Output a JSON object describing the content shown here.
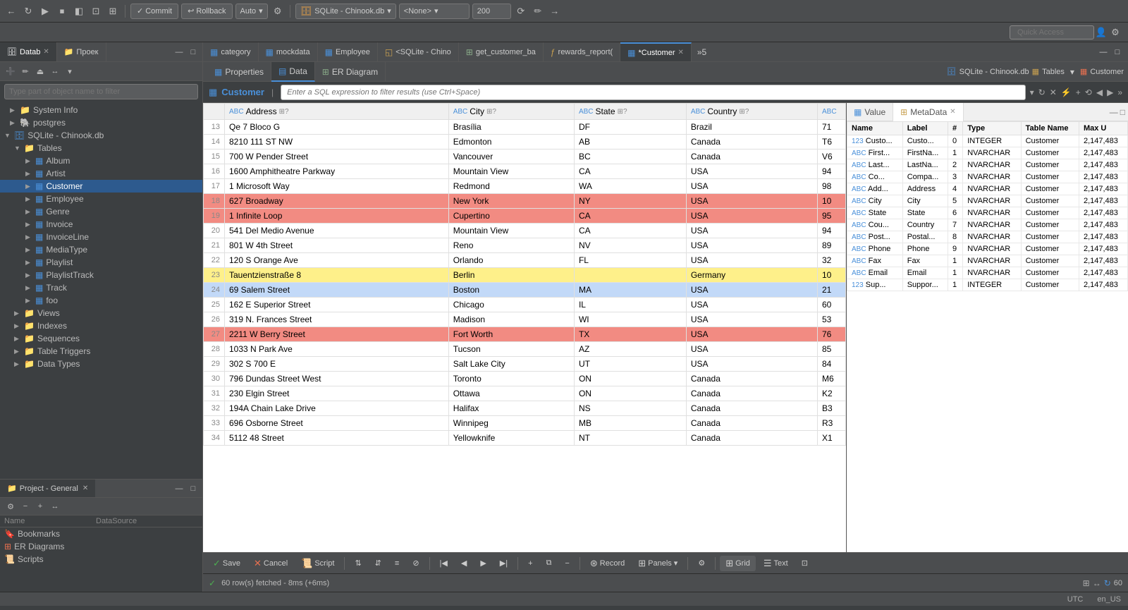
{
  "toolbar": {
    "commit_label": "Commit",
    "rollback_label": "Rollback",
    "auto_label": "Auto",
    "db_label": "SQLite - Chinook.db",
    "schema_label": "<None>",
    "rows_label": "200",
    "quick_access_label": "Quick Access"
  },
  "sidebar": {
    "tab1": "Datab",
    "tab2": "Проек",
    "filter_placeholder": "Type part of object name to filter",
    "tree_items": [
      {
        "id": "sys",
        "label": "System Info",
        "icon": "folder",
        "level": 1,
        "expanded": false
      },
      {
        "id": "pg",
        "label": "postgres",
        "icon": "db",
        "level": 1,
        "expanded": false
      },
      {
        "id": "sqlite",
        "label": "SQLite - Chinook.db",
        "icon": "db",
        "level": 1,
        "expanded": true
      },
      {
        "id": "tables",
        "label": "Tables",
        "icon": "folder",
        "level": 2,
        "expanded": true
      },
      {
        "id": "album",
        "label": "Album",
        "icon": "table",
        "level": 3
      },
      {
        "id": "artist",
        "label": "Artist",
        "icon": "table",
        "level": 3
      },
      {
        "id": "customer",
        "label": "Customer",
        "icon": "table",
        "level": 3,
        "selected": true
      },
      {
        "id": "employee",
        "label": "Employee",
        "icon": "table",
        "level": 3
      },
      {
        "id": "genre",
        "label": "Genre",
        "icon": "table",
        "level": 3
      },
      {
        "id": "invoice",
        "label": "Invoice",
        "icon": "table",
        "level": 3
      },
      {
        "id": "invoiceline",
        "label": "InvoiceLine",
        "icon": "table",
        "level": 3
      },
      {
        "id": "mediatype",
        "label": "MediaType",
        "icon": "table",
        "level": 3
      },
      {
        "id": "playlist",
        "label": "Playlist",
        "icon": "table",
        "level": 3
      },
      {
        "id": "playlisttrack",
        "label": "PlaylistTrack",
        "icon": "table",
        "level": 3
      },
      {
        "id": "track",
        "label": "Track",
        "icon": "table",
        "level": 3
      },
      {
        "id": "foo",
        "label": "foo",
        "icon": "table",
        "level": 3
      },
      {
        "id": "views",
        "label": "Views",
        "icon": "folder",
        "level": 2,
        "expanded": false
      },
      {
        "id": "indexes",
        "label": "Indexes",
        "icon": "folder",
        "level": 2,
        "expanded": false
      },
      {
        "id": "sequences",
        "label": "Sequences",
        "icon": "folder",
        "level": 2,
        "expanded": false
      },
      {
        "id": "tabletriggers",
        "label": "Table Triggers",
        "icon": "folder",
        "level": 2,
        "expanded": false
      },
      {
        "id": "datatypes",
        "label": "Data Types",
        "icon": "folder",
        "level": 2,
        "expanded": false
      }
    ]
  },
  "project": {
    "tab_label": "Project - General",
    "name_col": "Name",
    "datasource_col": "DataSource",
    "items": [
      {
        "name": "Bookmarks",
        "icon": "bookmark",
        "datasource": ""
      },
      {
        "name": "ER Diagrams",
        "icon": "er",
        "datasource": ""
      },
      {
        "name": "Scripts",
        "icon": "script",
        "datasource": ""
      }
    ]
  },
  "editor_tabs": [
    {
      "label": "category",
      "icon": "table",
      "active": false
    },
    {
      "label": "mockdata",
      "icon": "table",
      "active": false
    },
    {
      "label": "Employee",
      "icon": "table",
      "active": false
    },
    {
      "label": "<SQLite - Chino",
      "icon": "sql",
      "active": false
    },
    {
      "label": "get_customer_ba",
      "icon": "view",
      "active": false
    },
    {
      "label": "rewards_report(",
      "icon": "func",
      "active": false
    },
    {
      "label": "*Customer",
      "icon": "table",
      "active": true,
      "modified": true
    },
    {
      "label": "»5",
      "more": true
    }
  ],
  "sub_tabs": [
    {
      "label": "Properties",
      "icon": "props",
      "active": false
    },
    {
      "label": "Data",
      "icon": "data",
      "active": true
    },
    {
      "label": "ER Diagram",
      "icon": "er",
      "active": false
    }
  ],
  "sub_toolbar_right": {
    "db_label": "SQLite - Chinook.db",
    "tables_label": "Tables",
    "customer_label": "Customer"
  },
  "filter": {
    "table_name": "Customer",
    "placeholder": "Enter a SQL expression to filter results (use Ctrl+Space)"
  },
  "table_columns": [
    {
      "label": "Address",
      "type": "ABC"
    },
    {
      "label": "City",
      "type": "ABC"
    },
    {
      "label": "State",
      "type": "ABC"
    },
    {
      "label": "Country",
      "type": "ABC"
    },
    {
      "label": "...",
      "type": "ABC"
    }
  ],
  "table_rows": [
    {
      "num": 13,
      "address": "Qe 7 Bloco G",
      "city": "Brasília",
      "state": "DF",
      "country": "Brazil",
      "extra": "71",
      "style": ""
    },
    {
      "num": 14,
      "address": "8210 111 ST NW",
      "city": "Edmonton",
      "state": "AB",
      "country": "Canada",
      "extra": "T6",
      "style": ""
    },
    {
      "num": 15,
      "address": "700 W Pender Street",
      "city": "Vancouver",
      "state": "BC",
      "country": "Canada",
      "extra": "V6",
      "style": ""
    },
    {
      "num": 16,
      "address": "1600 Amphitheatre Parkway",
      "city": "Mountain View",
      "state": "CA",
      "country": "USA",
      "extra": "94",
      "style": ""
    },
    {
      "num": 17,
      "address": "1 Microsoft Way",
      "city": "Redmond",
      "state": "WA",
      "country": "USA",
      "extra": "98",
      "style": ""
    },
    {
      "num": 18,
      "address": "627 Broadway",
      "city": "New York",
      "state": "NY",
      "country": "USA",
      "extra": "10",
      "style": "row-red"
    },
    {
      "num": 19,
      "address": "1 Infinite Loop",
      "city": "Cupertino",
      "state": "CA",
      "country": "USA",
      "extra": "95",
      "style": "row-red"
    },
    {
      "num": 20,
      "address": "541 Del Medio Avenue",
      "city": "Mountain View",
      "state": "CA",
      "country": "USA",
      "extra": "94",
      "style": ""
    },
    {
      "num": 21,
      "address": "801 W 4th Street",
      "city": "Reno",
      "state": "NV",
      "country": "USA",
      "extra": "89",
      "style": ""
    },
    {
      "num": 22,
      "address": "120 S Orange Ave",
      "city": "Orlando",
      "state": "FL",
      "country": "USA",
      "extra": "32",
      "style": ""
    },
    {
      "num": 23,
      "address": "Tauentzienstraße 8",
      "city": "Berlin",
      "state": "",
      "country": "Germany",
      "extra": "10",
      "style": "row-yellow"
    },
    {
      "num": 24,
      "address": "69 Salem Street",
      "city": "Boston",
      "state": "MA",
      "country": "USA",
      "extra": "21",
      "style": "row-selected"
    },
    {
      "num": 25,
      "address": "162 E Superior Street",
      "city": "Chicago",
      "state": "IL",
      "country": "USA",
      "extra": "60",
      "style": ""
    },
    {
      "num": 26,
      "address": "319 N. Frances Street",
      "city": "Madison",
      "state": "WI",
      "country": "USA",
      "extra": "53",
      "style": ""
    },
    {
      "num": 27,
      "address": "2211 W Berry Street",
      "city": "Fort Worth",
      "state": "TX",
      "country": "USA",
      "extra": "76",
      "style": "row-red"
    },
    {
      "num": 28,
      "address": "1033 N Park Ave",
      "city": "Tucson",
      "state": "AZ",
      "country": "USA",
      "extra": "85",
      "style": ""
    },
    {
      "num": 29,
      "address": "302 S 700 E",
      "city": "Salt Lake City",
      "state": "UT",
      "country": "USA",
      "extra": "84",
      "style": ""
    },
    {
      "num": 30,
      "address": "796 Dundas Street West",
      "city": "Toronto",
      "state": "ON",
      "country": "Canada",
      "extra": "M6",
      "style": ""
    },
    {
      "num": 31,
      "address": "230 Elgin Street",
      "city": "Ottawa",
      "state": "ON",
      "country": "Canada",
      "extra": "K2",
      "style": ""
    },
    {
      "num": 32,
      "address": "194A Chain Lake Drive",
      "city": "Halifax",
      "state": "NS",
      "country": "Canada",
      "extra": "B3",
      "style": ""
    },
    {
      "num": 33,
      "address": "696 Osborne Street",
      "city": "Winnipeg",
      "state": "MB",
      "country": "Canada",
      "extra": "R3",
      "style": ""
    },
    {
      "num": 34,
      "address": "5112 48 Street",
      "city": "Yellowknife",
      "state": "NT",
      "country": "Canada",
      "extra": "X1",
      "style": ""
    }
  ],
  "metadata": {
    "tab_value": "Value",
    "tab_meta": "MetaData",
    "columns": [
      "Name",
      "Label",
      "#",
      "Type",
      "Table Name",
      "Max U"
    ],
    "rows": [
      {
        "icon": "123",
        "name": "Custo...",
        "label": "Custo...",
        "num": "0",
        "type": "INTEGER",
        "table": "Customer",
        "max": "2,147,483"
      },
      {
        "icon": "ABC",
        "name": "First...",
        "label": "FirstNa...",
        "num": "1",
        "type": "NVARCHAR",
        "table": "Customer",
        "max": "2,147,483"
      },
      {
        "icon": "ABC",
        "name": "Last...",
        "label": "LastNa...",
        "num": "2",
        "type": "NVARCHAR",
        "table": "Customer",
        "max": "2,147,483"
      },
      {
        "icon": "ABC",
        "name": "Co...",
        "label": "Compa...",
        "num": "3",
        "type": "NVARCHAR",
        "table": "Customer",
        "max": "2,147,483"
      },
      {
        "icon": "ABC",
        "name": "Add...",
        "label": "Address",
        "num": "4",
        "type": "NVARCHAR",
        "table": "Customer",
        "max": "2,147,483"
      },
      {
        "icon": "ABC",
        "name": "City",
        "label": "City",
        "num": "5",
        "type": "NVARCHAR",
        "table": "Customer",
        "max": "2,147,483"
      },
      {
        "icon": "ABC",
        "name": "State",
        "label": "State",
        "num": "6",
        "type": "NVARCHAR",
        "table": "Customer",
        "max": "2,147,483"
      },
      {
        "icon": "ABC",
        "name": "Cou...",
        "label": "Country",
        "num": "7",
        "type": "NVARCHAR",
        "table": "Customer",
        "max": "2,147,483"
      },
      {
        "icon": "ABC",
        "name": "Post...",
        "label": "Postal...",
        "num": "8",
        "type": "NVARCHAR",
        "table": "Customer",
        "max": "2,147,483"
      },
      {
        "icon": "ABC",
        "name": "Phone",
        "label": "Phone",
        "num": "9",
        "type": "NVARCHAR",
        "table": "Customer",
        "max": "2,147,483"
      },
      {
        "icon": "ABC",
        "name": "Fax",
        "label": "Fax",
        "num": "1",
        "type": "NVARCHAR",
        "table": "Customer",
        "max": "2,147,483"
      },
      {
        "icon": "ABC",
        "name": "Email",
        "label": "Email",
        "num": "1",
        "type": "NVARCHAR",
        "table": "Customer",
        "max": "2,147,483"
      },
      {
        "icon": "123",
        "name": "Sup...",
        "label": "Suppor...",
        "num": "1",
        "type": "INTEGER",
        "table": "Customer",
        "max": "2,147,483"
      }
    ]
  },
  "bottom_toolbar": {
    "save": "Save",
    "cancel": "Cancel",
    "script": "Script",
    "record": "Record",
    "panels": "Panels",
    "grid": "Grid",
    "text": "Text"
  },
  "status_bar": {
    "message": "60 row(s) fetched - 8ms (+6ms)",
    "rows": "60"
  },
  "global_status": {
    "utc": "UTC",
    "locale": "en_US"
  }
}
